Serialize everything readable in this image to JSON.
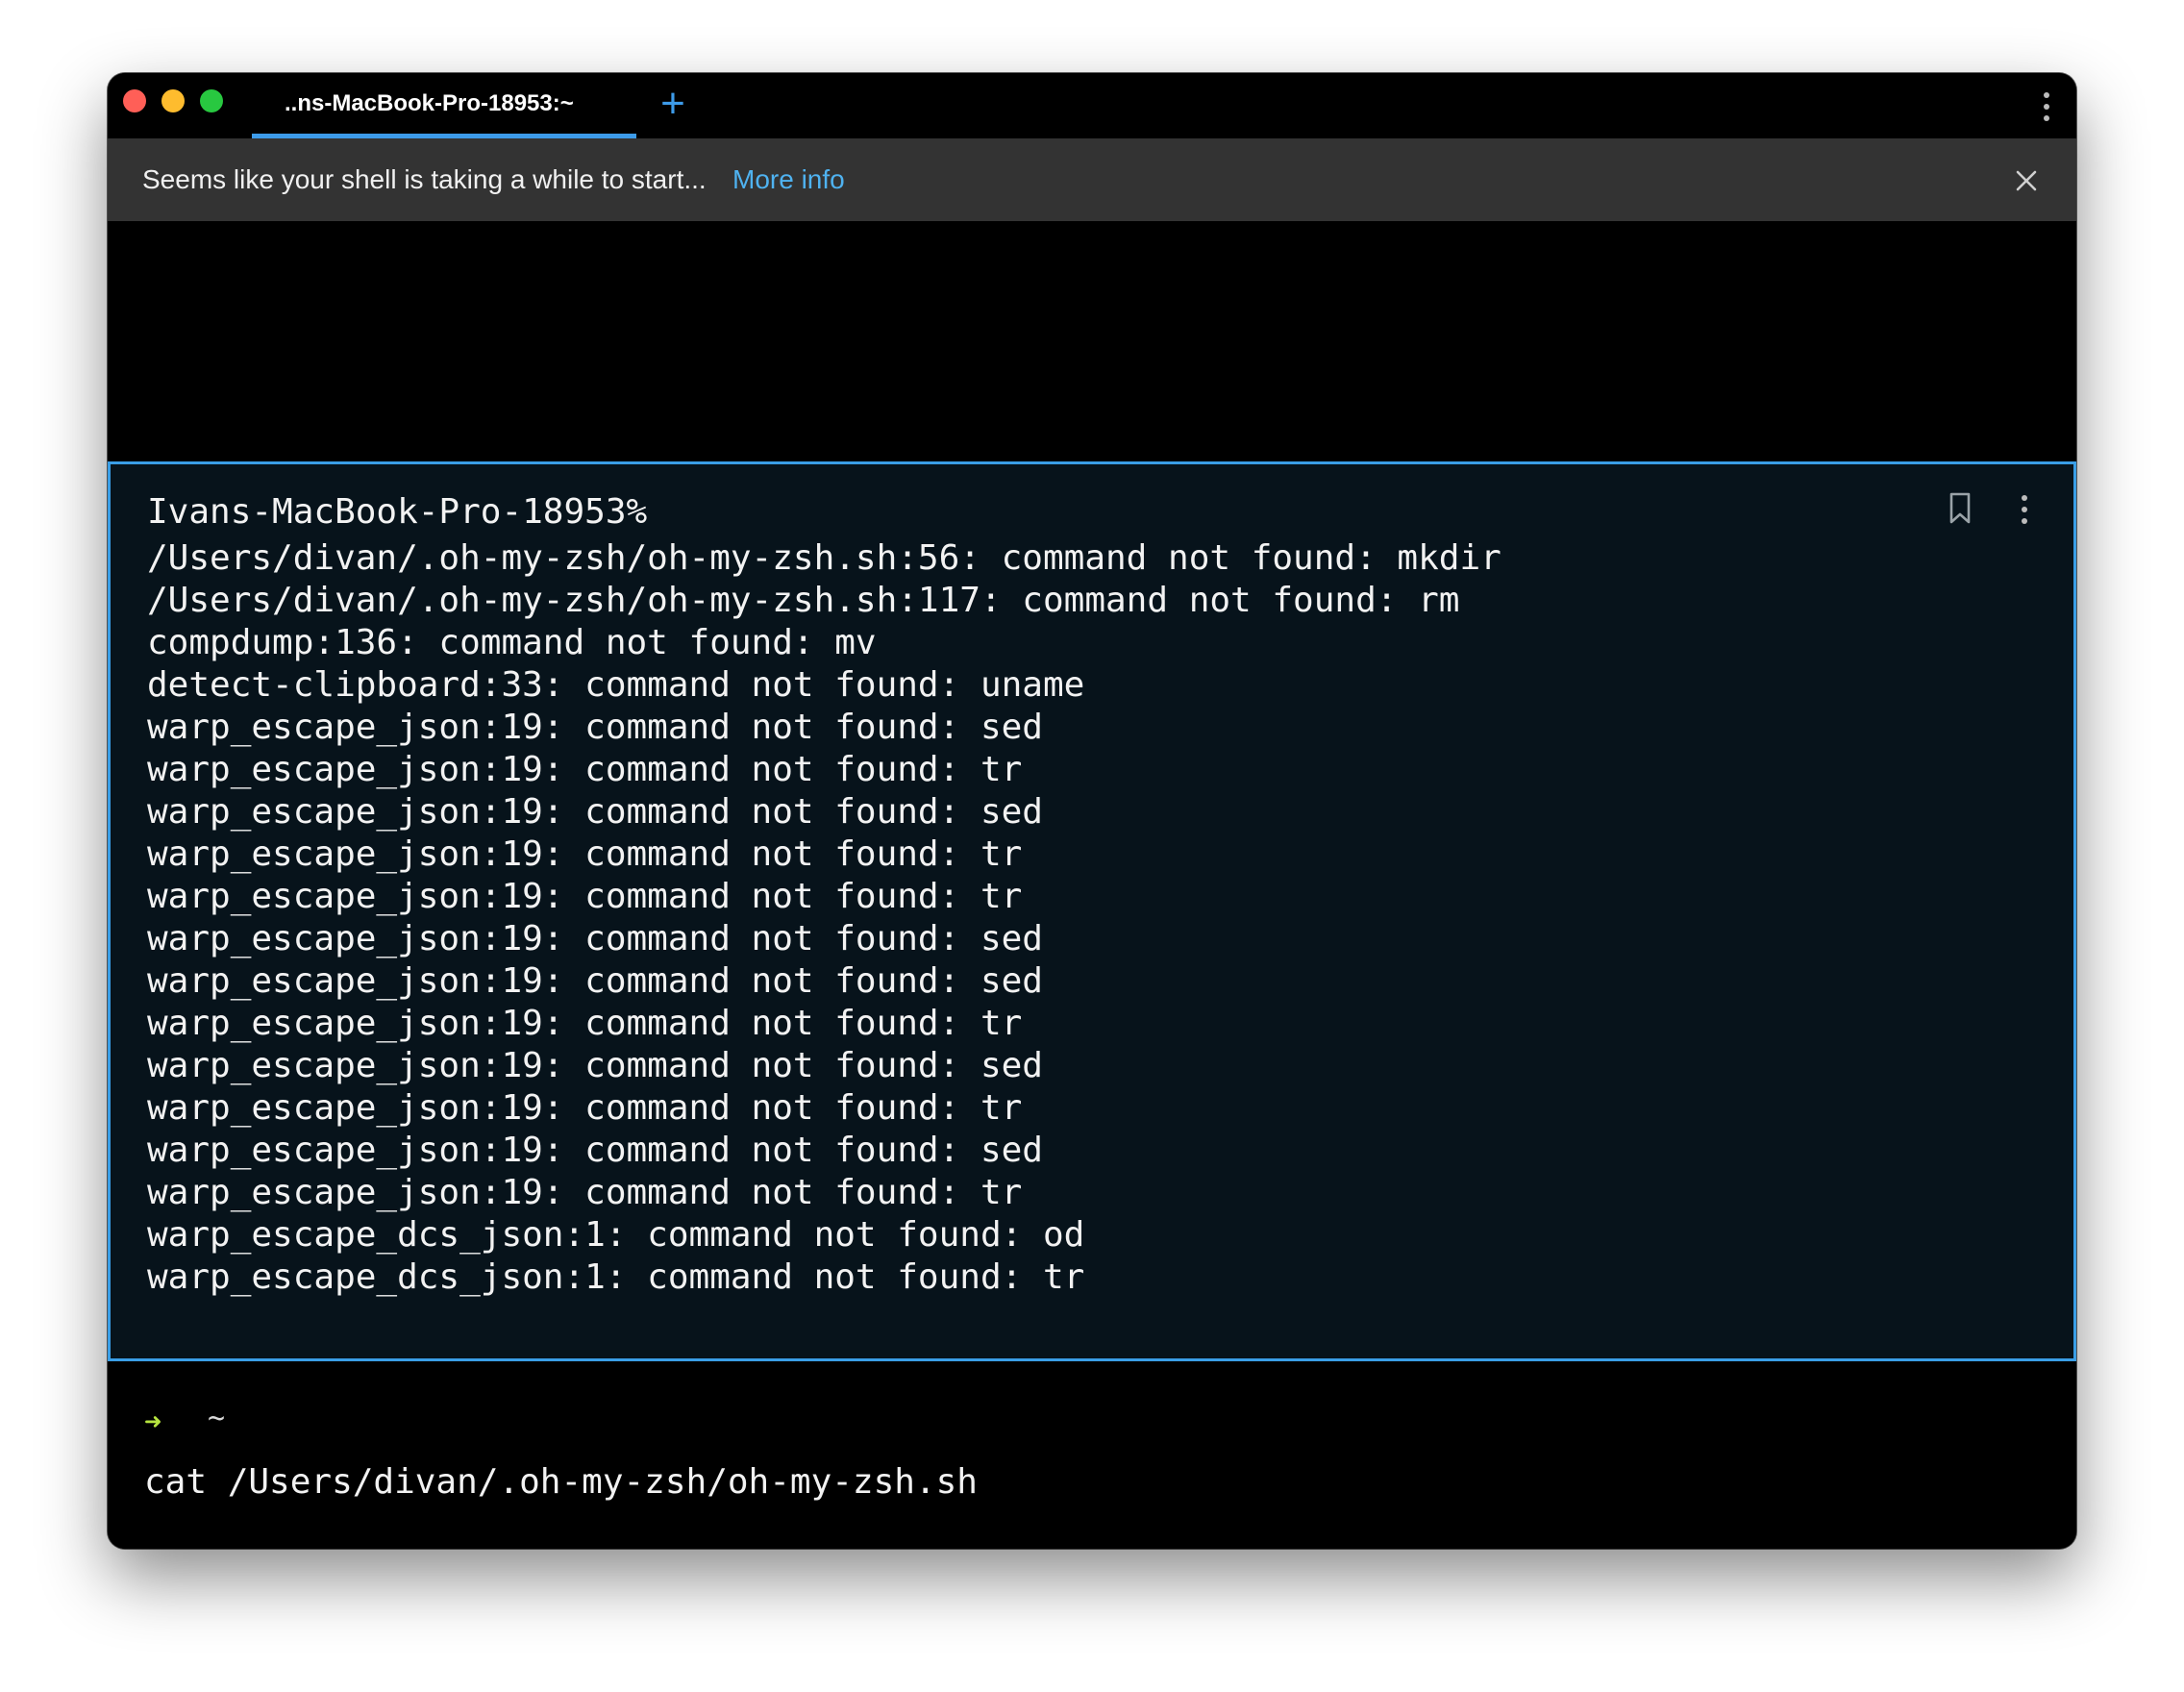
{
  "titlebar": {
    "tab_title": "..ns-MacBook-Pro-18953:~",
    "new_tab_glyph": "+"
  },
  "banner": {
    "message": "Seems like your shell is taking a while to start...",
    "link_label": "More info"
  },
  "block": {
    "prompt": "Ivans-MacBook-Pro-18953%",
    "output_lines": [
      "/Users/divan/.oh-my-zsh/oh-my-zsh.sh:56: command not found: mkdir",
      "/Users/divan/.oh-my-zsh/oh-my-zsh.sh:117: command not found: rm",
      "compdump:136: command not found: mv",
      "detect-clipboard:33: command not found: uname",
      "warp_escape_json:19: command not found: sed",
      "warp_escape_json:19: command not found: tr",
      "warp_escape_json:19: command not found: sed",
      "warp_escape_json:19: command not found: tr",
      "warp_escape_json:19: command not found: tr",
      "warp_escape_json:19: command not found: sed",
      "warp_escape_json:19: command not found: sed",
      "warp_escape_json:19: command not found: tr",
      "warp_escape_json:19: command not found: sed",
      "warp_escape_json:19: command not found: tr",
      "warp_escape_json:19: command not found: sed",
      "warp_escape_json:19: command not found: tr",
      "warp_escape_dcs_json:1: command not found: od",
      "warp_escape_dcs_json:1: command not found: tr"
    ]
  },
  "input": {
    "prompt_symbol": "➜",
    "directory": "~",
    "command": "cat /Users/divan/.oh-my-zsh/oh-my-zsh.sh"
  },
  "colors": {
    "accent": "#3d9be9",
    "link": "#4fb2f0",
    "prompt_arrow": "#b6e33f",
    "block_background": "#07131b",
    "banner_background": "#333333"
  },
  "icons": {
    "window_close": "close-window-icon",
    "window_minimize": "minimize-window-icon",
    "window_zoom": "zoom-window-icon",
    "new_tab": "plus-icon",
    "window_menu": "kebab-menu-icon",
    "banner_close": "close-icon",
    "bookmark": "bookmark-icon",
    "block_menu": "kebab-menu-icon"
  }
}
